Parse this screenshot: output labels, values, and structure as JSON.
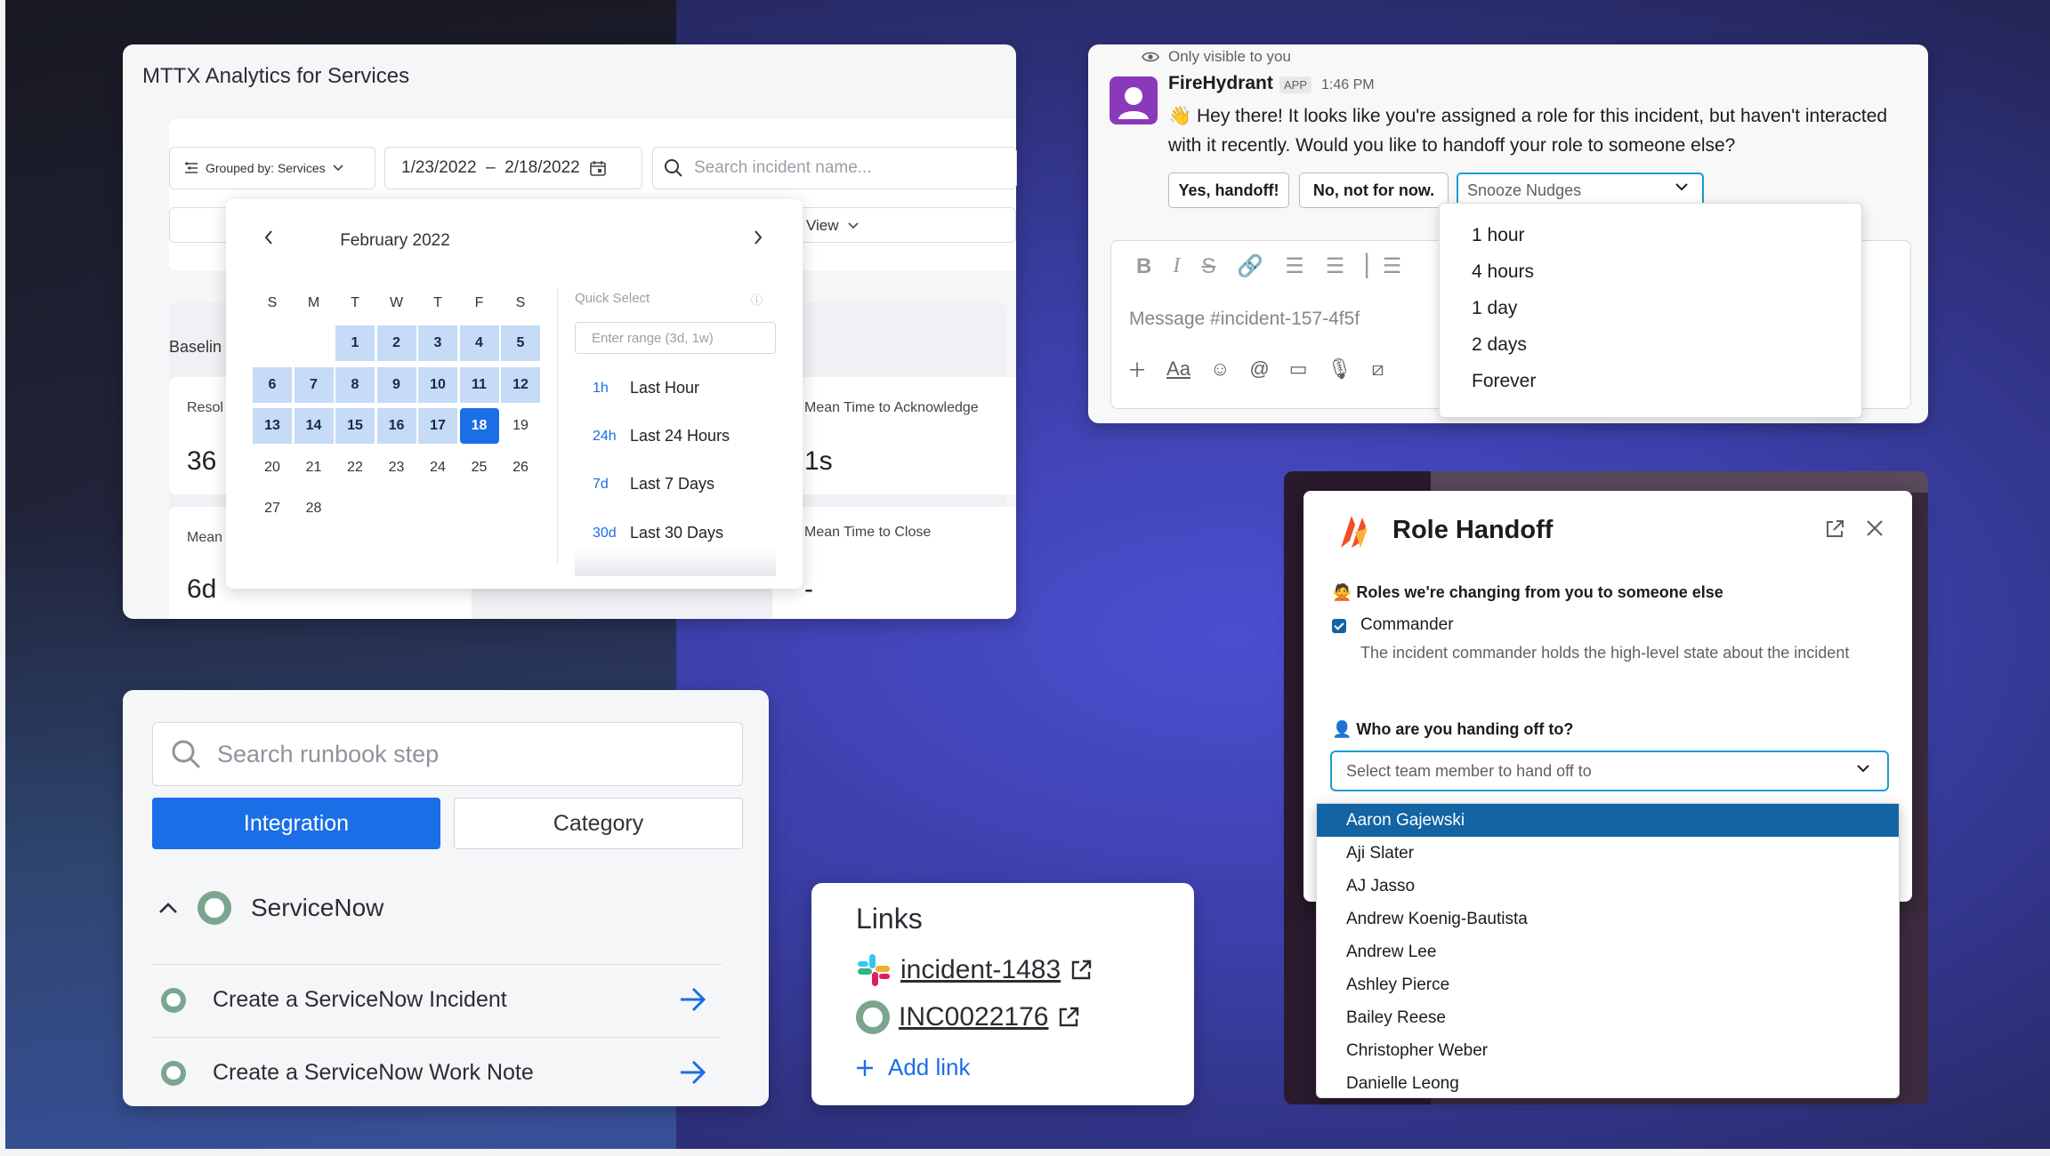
{
  "mttx": {
    "title": "MTTX Analytics for Services",
    "grouped_by": "Grouped by: Services",
    "date_range": "1/23/2022  –  2/18/2022",
    "search_placeholder": "Search incident name...",
    "view_label": "View",
    "baseline_label": "Baselin",
    "stats": [
      {
        "label": "Resol",
        "value": "36"
      },
      {
        "label": "Mean Time to Acknowledge",
        "value": "1s"
      },
      {
        "label": "Mean",
        "value": "6d"
      },
      {
        "label": "Mean Time to Close",
        "value": "-"
      }
    ],
    "calendar": {
      "month": "February 2022",
      "weekdays": [
        "S",
        "M",
        "T",
        "W",
        "T",
        "F",
        "S"
      ],
      "days": [
        "1",
        "2",
        "3",
        "4",
        "5",
        "6",
        "7",
        "8",
        "9",
        "10",
        "11",
        "12",
        "13",
        "14",
        "15",
        "16",
        "17",
        "18",
        "19",
        "20",
        "21",
        "22",
        "23",
        "24",
        "25",
        "26",
        "27",
        "28"
      ],
      "selected_day": "18",
      "quick_select_title": "Quick Select",
      "range_placeholder": "Enter range (3d, 1w)",
      "quick_options": [
        {
          "abbr": "1h",
          "label": "Last Hour"
        },
        {
          "abbr": "24h",
          "label": "Last 24 Hours"
        },
        {
          "abbr": "7d",
          "label": "Last 7 Days"
        },
        {
          "abbr": "30d",
          "label": "Last 30 Days"
        }
      ]
    }
  },
  "slack": {
    "only_visible": "Only visible to you",
    "sender": "FireHydrant",
    "app_badge": "APP",
    "time": "1:46 PM",
    "message": "👋 Hey there! It looks like you're assigned a role for this incident, but haven't interacted with it recently. Would you like to handoff your role to someone else?",
    "buttons": [
      "Yes, handoff!",
      "No, not for now."
    ],
    "snooze_placeholder": "Snooze Nudges",
    "composer_placeholder": "Message #incident-157-4f5f",
    "snooze_options": [
      "1 hour",
      "4 hours",
      "1 day",
      "2 days",
      "Forever"
    ]
  },
  "runbook": {
    "search_placeholder": "Search runbook step",
    "tabs": [
      "Integration",
      "Category"
    ],
    "group": "ServiceNow",
    "steps": [
      "Create a ServiceNow Incident",
      "Create a ServiceNow Work Note"
    ]
  },
  "links": {
    "title": "Links",
    "items": [
      "incident-1483",
      "INC0022176"
    ],
    "add_label": "Add link"
  },
  "role_handoff": {
    "title": "Role Handoff",
    "section_roles": "🙅 Roles we're changing from you to someone else",
    "role_name": "Commander",
    "role_desc": "The incident commander holds the high-level state about the incident",
    "section_who": "👤 Who are you handing off to?",
    "select_placeholder": "Select team member to hand off to",
    "members": [
      "Aaron Gajewski",
      "Aji Slater",
      "AJ Jasso",
      "Andrew Koenig-Bautista",
      "Andrew Lee",
      "Ashley Pierce",
      "Bailey Reese",
      "Christopher Weber",
      "Danielle Leong"
    ]
  },
  "colors": {
    "accent_blue": "#1a6ee6",
    "slack_blue": "#1264a3",
    "firehydrant_orange": "#f04e23"
  }
}
